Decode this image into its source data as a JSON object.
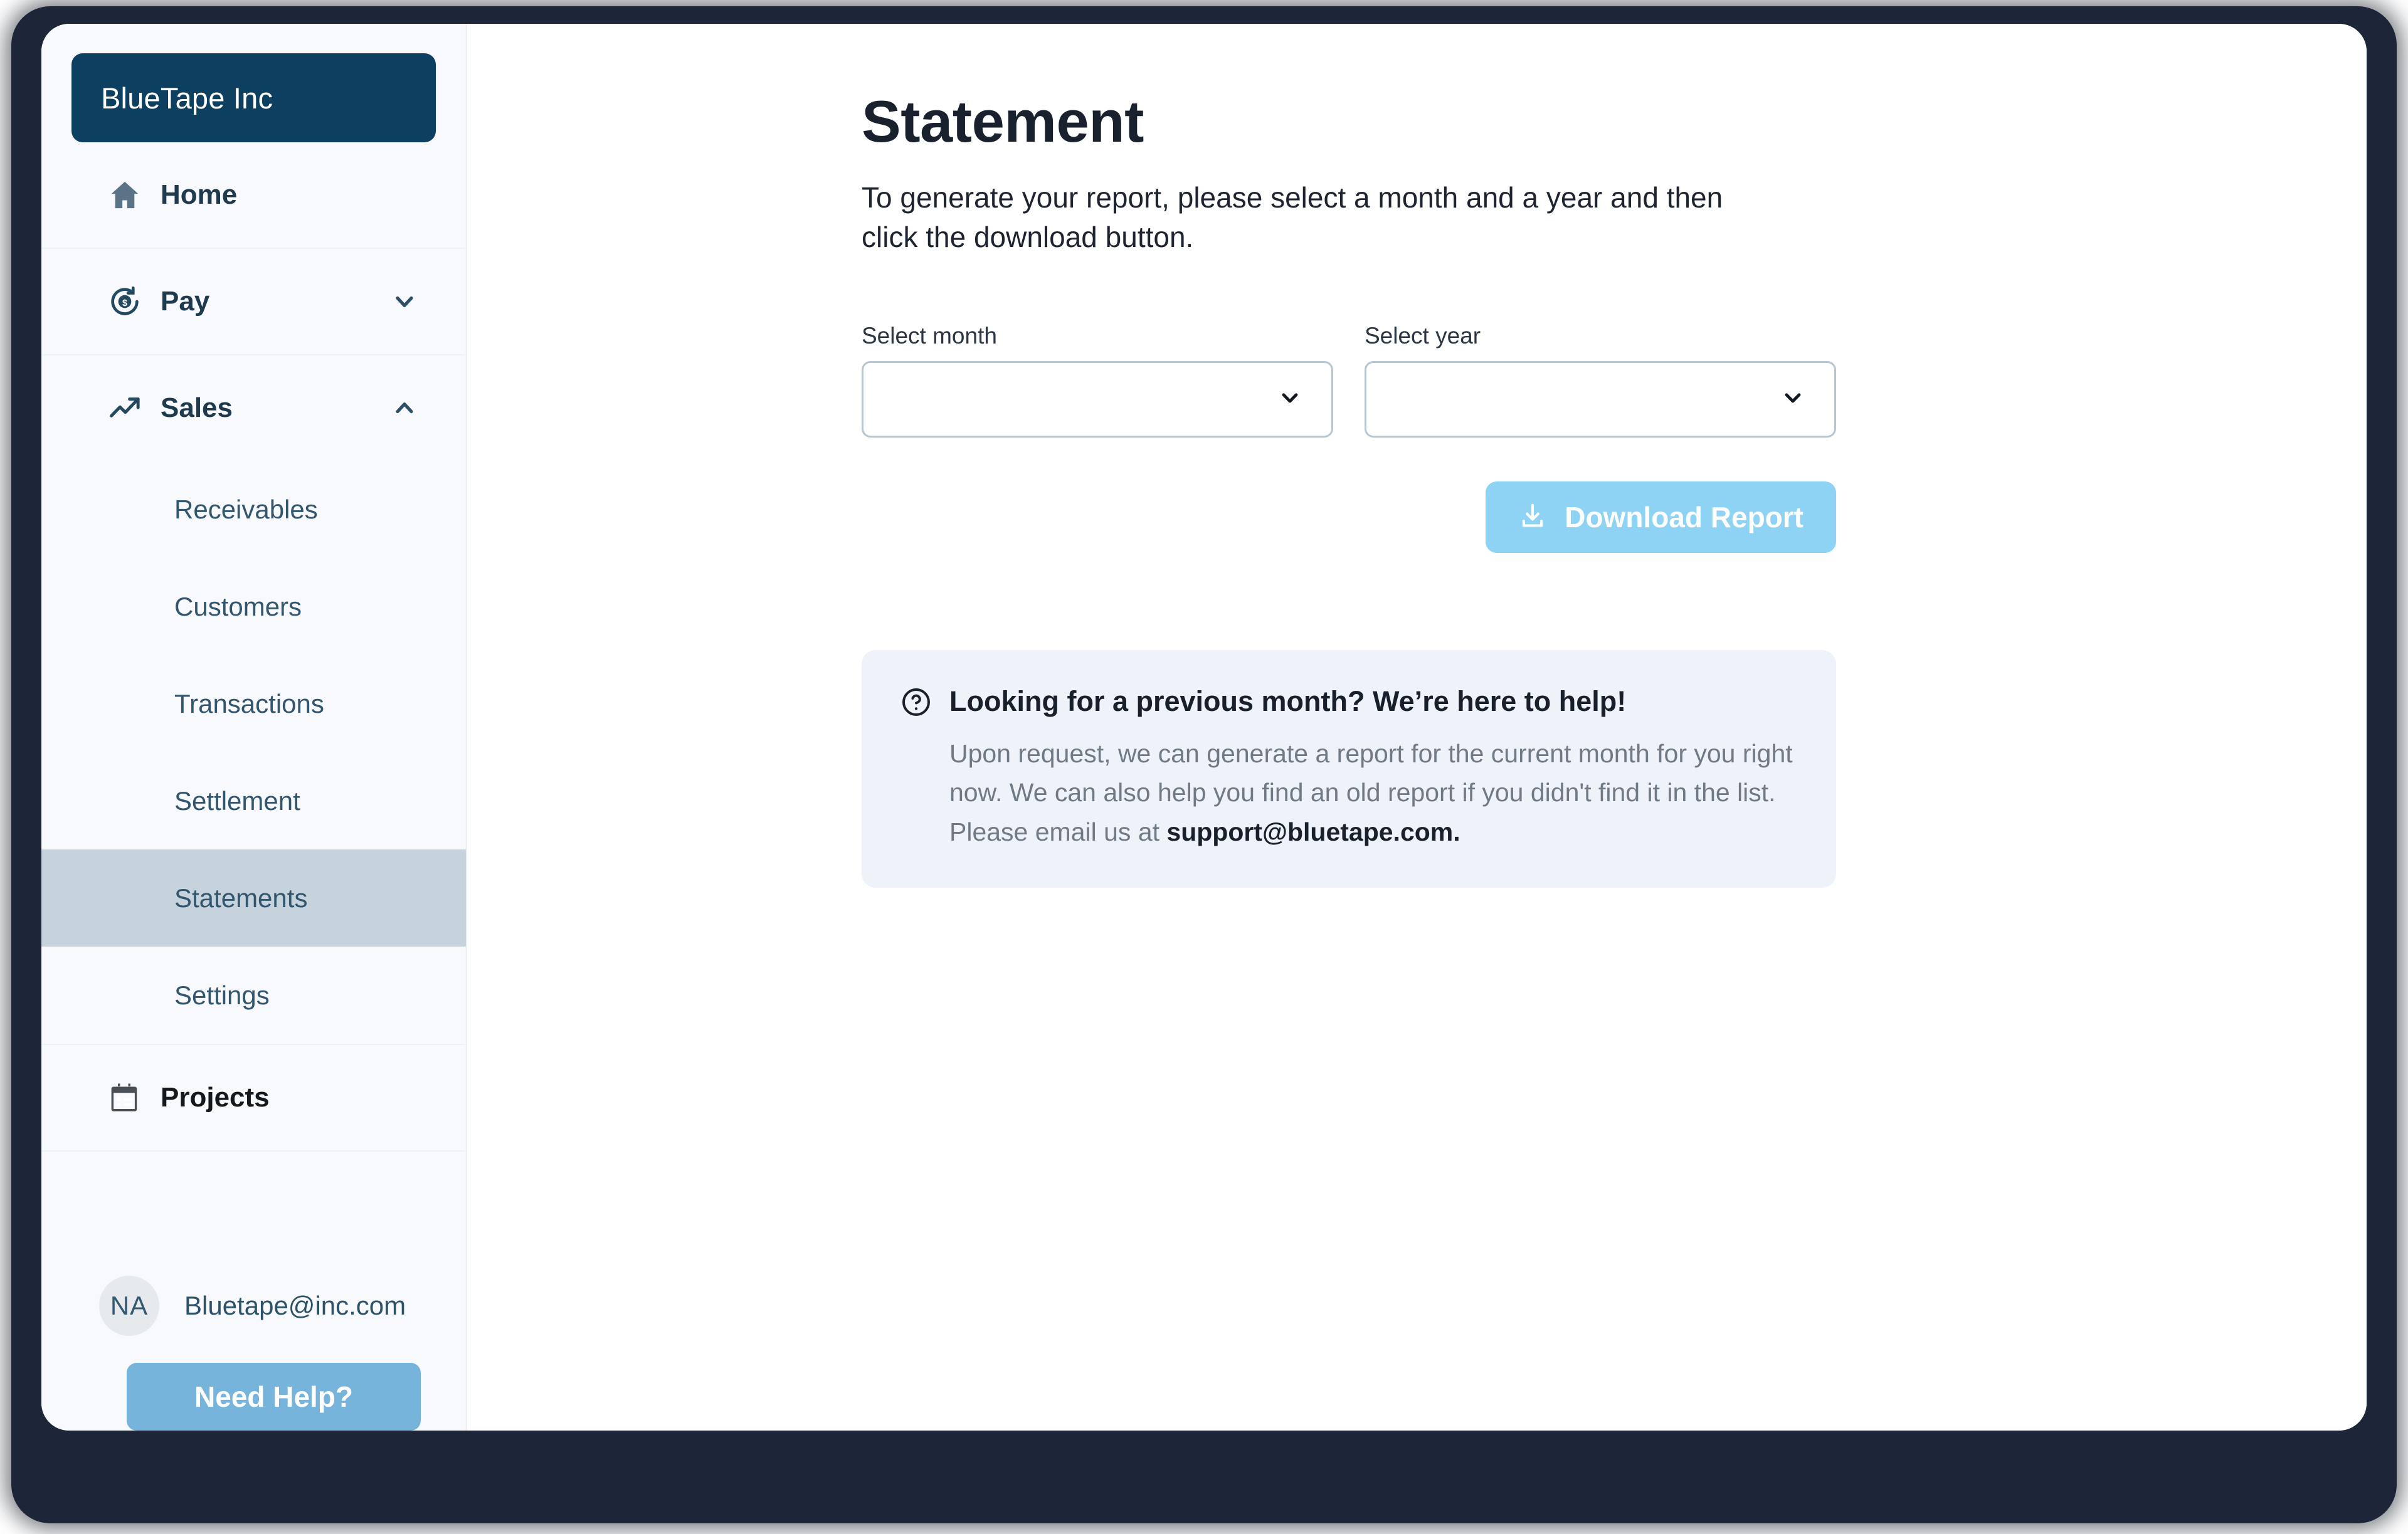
{
  "sidebar": {
    "logo": "BlueTape Inc",
    "nav": [
      {
        "label": "Home",
        "icon": "home-icon",
        "chevron": ""
      },
      {
        "label": "Pay",
        "icon": "dollar-cycle-icon",
        "chevron": "chevron-down-icon"
      },
      {
        "label": "Sales",
        "icon": "trending-up-icon",
        "chevron": "chevron-up-icon"
      },
      {
        "label": "Projects",
        "icon": "calendar-icon",
        "chevron": ""
      }
    ],
    "sales_subitems": [
      {
        "label": "Receivables",
        "active": false
      },
      {
        "label": "Customers",
        "active": false
      },
      {
        "label": "Transactions",
        "active": false
      },
      {
        "label": "Settlement",
        "active": false
      },
      {
        "label": "Statements",
        "active": true
      },
      {
        "label": "Settings",
        "active": false
      }
    ],
    "user": {
      "initials": "NA",
      "email": "Bluetape@inc.com"
    },
    "help_button": "Need Help?"
  },
  "main": {
    "title": "Statement",
    "subtitle": "To generate your report, please select a month and a year and then click the download button.",
    "month_field": {
      "label": "Select month",
      "value": "",
      "placeholder": ""
    },
    "year_field": {
      "label": "Select year",
      "value": "",
      "placeholder": ""
    },
    "download_button": "Download Report",
    "callout": {
      "title": "Looking for a previous month? We’re here to help!",
      "text_before": "Upon request, we can generate a report for the current month for you right now. We can also help you find an old report if you didn't find it in the list. Please email us at ",
      "email": "support@bluetape.com."
    }
  },
  "colors": {
    "frame": "#1c2638",
    "logo_bg": "#0d4060",
    "sidebar_bg": "#f7f9fc",
    "active_item": "#c6d2dc",
    "download_button": "#8ed2f4",
    "help_button": "#76b4db",
    "callout_bg": "#eef3fa",
    "select_border": "#b7c7d2",
    "icon_slate": "#5a7386"
  }
}
